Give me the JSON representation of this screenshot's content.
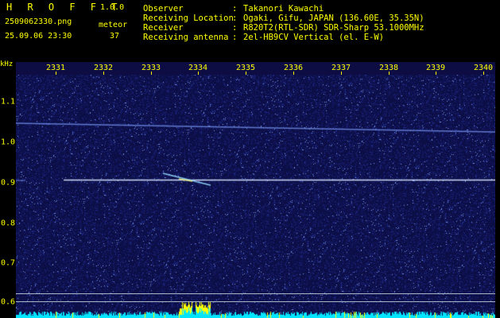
{
  "header": {
    "brand": "H R O F F T",
    "version": "1.0.0",
    "filename": "2509062330.png",
    "meteor_label": "meteor",
    "datetime": "25.09.06 23:30",
    "meteor_count": "37",
    "info": [
      {
        "key": "Observer",
        "value": "Takanori Kawachi"
      },
      {
        "key": "Receiving Location",
        "value": "Ogaki, Gifu, JAPAN (136.60E, 35.35N)"
      },
      {
        "key": "Receiver",
        "value": "R820T2(RTL-SDR) SDR-Sharp 53.1000MHz"
      },
      {
        "key": "Receiving antenna",
        "value": "2el-HB9CV Vertical (el. E-W)"
      }
    ]
  },
  "axes": {
    "y_unit": "kHz",
    "minutes": [
      "2331",
      "2332",
      "2333",
      "2334",
      "2335",
      "2336",
      "2337",
      "2338",
      "2339",
      "2340"
    ],
    "y_ticks": [
      "1.1",
      "1.0",
      "0.9",
      "0.8",
      "0.7",
      "0.6"
    ]
  },
  "colors": {
    "label": "#ffff00",
    "background": "#0d0d44",
    "carrier": "#d8e8ff",
    "noise_bar": "#00e5ff"
  }
}
